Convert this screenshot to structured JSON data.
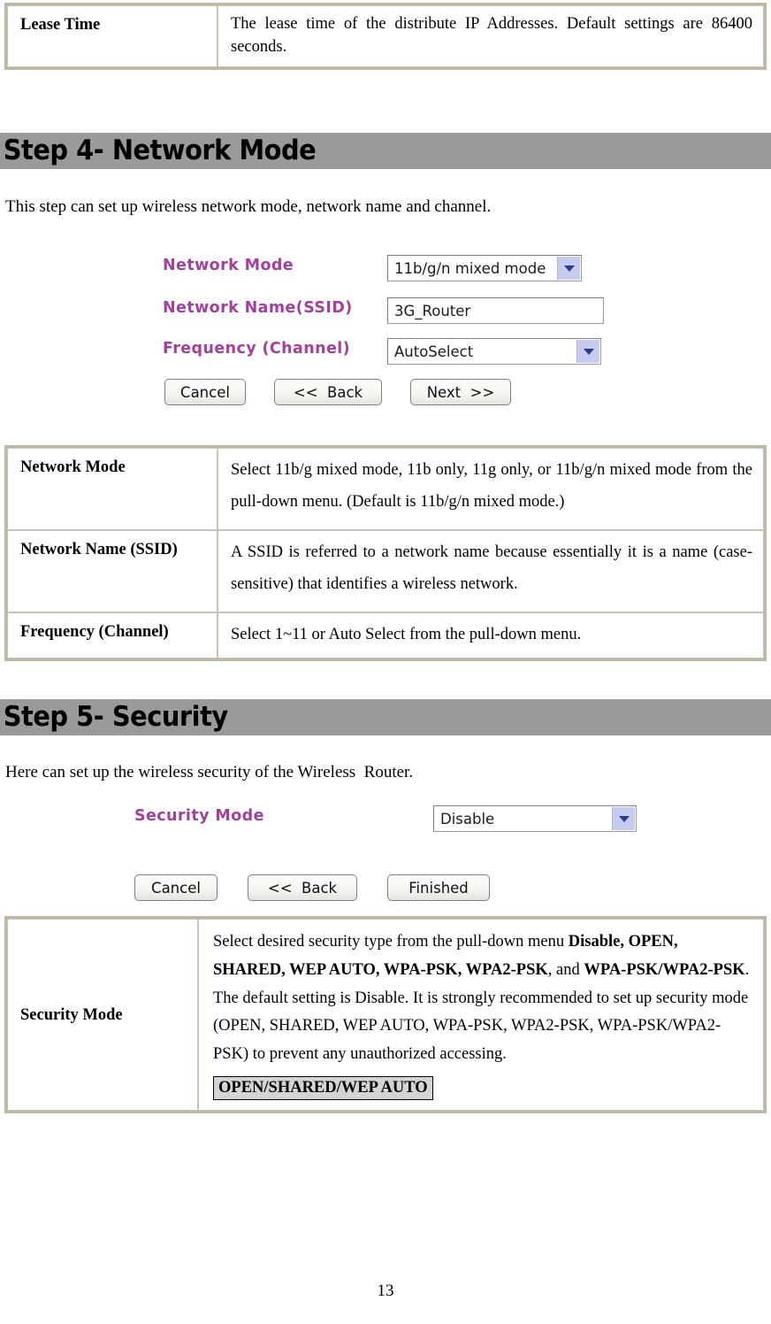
{
  "lease_time_table": {
    "rows": [
      {
        "label": "Lease Time",
        "desc": "The lease time of the distribute IP Addresses. Default settings are 86400 seconds."
      }
    ]
  },
  "step4": {
    "title": "Step 4- Network Mode",
    "intro": "This step can set up wireless network mode, network name and channel.",
    "screenshot": {
      "labels": {
        "network_mode": "Network Mode",
        "network_name": "Network Name(SSID)",
        "frequency": "Frequency (Channel)"
      },
      "values": {
        "network_mode": "11b/g/n mixed mode",
        "network_name": "3G_Router",
        "frequency": "AutoSelect"
      },
      "buttons": {
        "cancel": "Cancel",
        "back": "<<  Back",
        "next": "Next  >>"
      }
    },
    "table": {
      "rows": [
        {
          "label": "Network Mode",
          "desc": "Select 11b/g mixed mode, 11b only, 11g only, or 11b/g/n mixed mode from the pull-down menu. (Default is 11b/g/n mixed mode.)"
        },
        {
          "label": "Network Name (SSID)",
          "desc": "A SSID is referred to a network name because essentially it is a name (case-sensitive) that identifies a wireless network."
        },
        {
          "label": "Frequency (Channel)",
          "desc": "Select 1~11 or Auto Select from the pull-down menu."
        }
      ]
    }
  },
  "step5": {
    "title": "Step 5- Security",
    "intro": "Here can set up the wireless security of the Wireless  Router.",
    "screenshot": {
      "labels": {
        "security_mode": "Security Mode"
      },
      "values": {
        "security_mode": "Disable"
      },
      "buttons": {
        "cancel": "Cancel",
        "back": "<<  Back",
        "finished": "Finished"
      }
    },
    "table": {
      "row_label": "Security Mode",
      "desc_part1": "Select desired security type from the pull-down menu ",
      "desc_bold1": "Disable, OPEN, SHARED, WEP AUTO, WPA-PSK, WPA2-PSK",
      "desc_part2": ", and ",
      "desc_bold2": "WPA-PSK/WPA2-PSK",
      "desc_part3": ". The default setting is Disable. It is strongly recommended to set up security mode (OPEN, SHARED, WEP AUTO, WPA-PSK, WPA2-PSK, WPA-PSK/WPA2-PSK) to prevent any unauthorized accessing.",
      "highlight": "OPEN/SHARED/WEP AUTO"
    }
  },
  "page_number": "13",
  "colors": {
    "section_bar": "#9a9a9a",
    "form_label": "#a33f9e",
    "table_outer_border": "#bdb8a4",
    "dropdown_arrow_bg": "#c6ccf0",
    "highlight_bg": "#d4d4d4"
  }
}
